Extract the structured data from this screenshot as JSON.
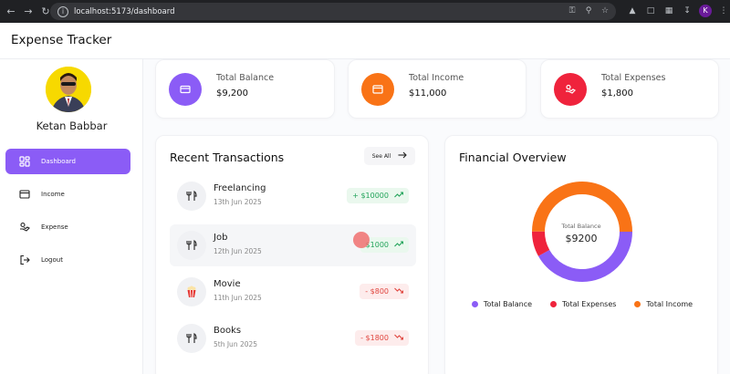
{
  "browser": {
    "url": "localhost:5173/dashboard",
    "profile_initial": "K"
  },
  "app": {
    "title": "Expense Tracker"
  },
  "sidebar": {
    "user_name": "Ketan Babbar",
    "items": [
      {
        "label": "Dashboard",
        "icon": "dashboard-icon",
        "active": true
      },
      {
        "label": "Income",
        "icon": "wallet-icon",
        "active": false
      },
      {
        "label": "Expense",
        "icon": "expense-hand-icon",
        "active": false
      },
      {
        "label": "Logout",
        "icon": "logout-icon",
        "active": false
      }
    ]
  },
  "stats": [
    {
      "label": "Total Balance",
      "value": "$9,200",
      "color": "#8b5cf6",
      "icon": "card-icon"
    },
    {
      "label": "Total Income",
      "value": "$11,000",
      "color": "#f97316",
      "icon": "wallet-icon"
    },
    {
      "label": "Total Expenses",
      "value": "$1,800",
      "color": "#ef233c",
      "icon": "expense-hand-icon"
    }
  ],
  "recent": {
    "title": "Recent Transactions",
    "see_all": "See All",
    "items": [
      {
        "name": "Freelancing",
        "date": "13th Jun 2025",
        "amount": "+ $10000",
        "type": "income",
        "icon": "cutlery-icon"
      },
      {
        "name": "Job",
        "date": "12th Jun 2025",
        "amount": "$1000",
        "type": "income",
        "icon": "cutlery-icon"
      },
      {
        "name": "Movie",
        "date": "11th Jun 2025",
        "amount": "- $800",
        "type": "expense",
        "icon": "popcorn-icon"
      },
      {
        "name": "Books",
        "date": "5th Jun 2025",
        "amount": "- $1800",
        "type": "expense",
        "icon": "cutlery-icon"
      }
    ]
  },
  "overview": {
    "title": "Financial Overview",
    "center_label": "Total Balance",
    "center_value": "$9200",
    "legend": [
      {
        "label": "Total Balance",
        "color": "#8b5cf6"
      },
      {
        "label": "Total Expenses",
        "color": "#ef233c"
      },
      {
        "label": "Total Income",
        "color": "#f97316"
      }
    ]
  },
  "chart_data": {
    "type": "pie",
    "categories": [
      "Total Balance",
      "Total Expenses",
      "Total Income"
    ],
    "values": [
      9200,
      1800,
      11000
    ],
    "colors": [
      "#8b5cf6",
      "#ef233c",
      "#f97316"
    ]
  }
}
